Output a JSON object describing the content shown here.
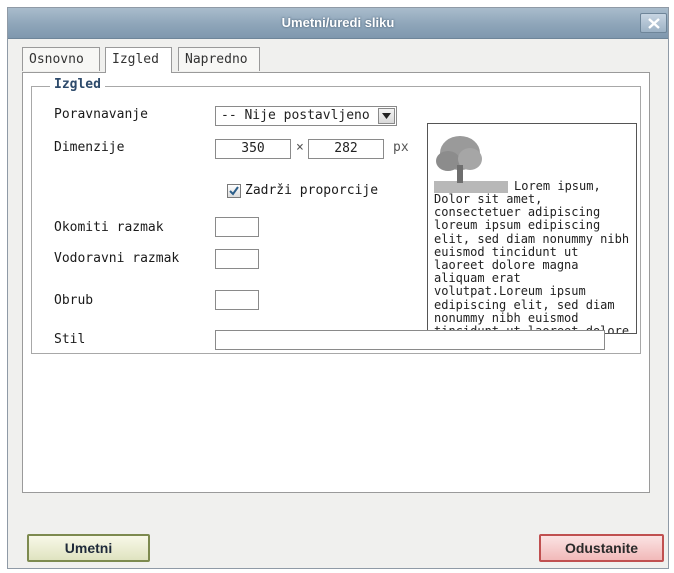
{
  "window": {
    "title": "Umetni/uredi sliku",
    "title_color": "#ffffff",
    "titlebar_color": "#8ea5b9"
  },
  "tabs": [
    {
      "label": "Osnovno",
      "active": false
    },
    {
      "label": "Izgled",
      "active": true
    },
    {
      "label": "Napredno",
      "active": false
    }
  ],
  "fieldset": {
    "legend": "Izgled",
    "alignment": {
      "label": "Poravnavanje",
      "selected": "-- Nije postavljeno --"
    },
    "dimensions": {
      "label": "Dimenzije",
      "width": "350",
      "separator": "×",
      "height": "282",
      "unit": "px"
    },
    "keep_proportions": {
      "label": "Zadrži proporcije",
      "checked": true
    },
    "vertical_space": {
      "label": "Okomiti razmak",
      "value": ""
    },
    "horizontal_space": {
      "label": "Vodoravni razmak",
      "value": ""
    },
    "border": {
      "label": "Obrub",
      "value": ""
    },
    "style": {
      "label": "Stil",
      "value": ""
    }
  },
  "preview": {
    "image_icon": "tree-image-icon",
    "first_line": "Lorem ipsum,",
    "text": "Dolor sit amet, consectetuer adipiscing loreum ipsum edipiscing elit, sed diam nonummy nibh euismod tincidunt ut laoreet dolore magna aliquam erat volutpat.Loreum ipsum edipiscing elit, sed diam nonummy nibh euismod tincidunt ut laoreet dolore magna aliquam erat volutpat."
  },
  "buttons": {
    "insert": "Umetni",
    "cancel": "Odustanite"
  },
  "colors": {
    "insert_border": "#7d8a4f",
    "cancel_border": "#c05050",
    "legend_text": "#2d4a6b"
  }
}
